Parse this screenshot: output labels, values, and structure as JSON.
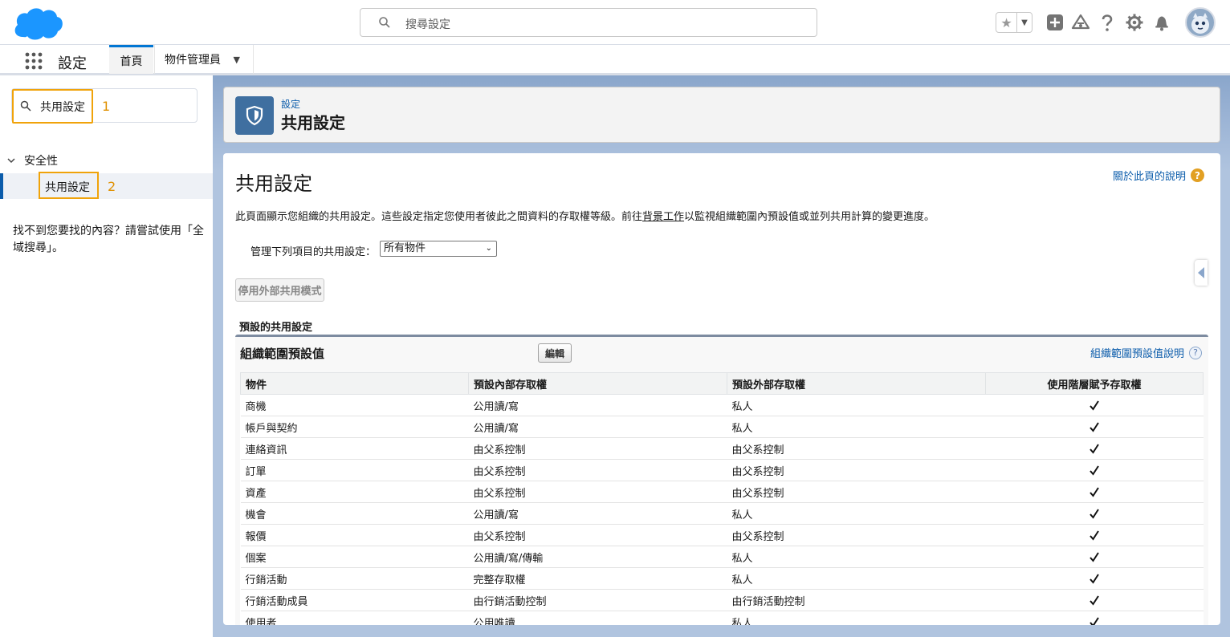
{
  "header": {
    "search_placeholder": "搜尋設定",
    "icons": [
      "salesforce-cloud-logo",
      "search-icon",
      "star-icon",
      "chevron-down-icon",
      "add-icon",
      "trailhead-icon",
      "help-icon",
      "gear-icon",
      "bell-icon",
      "avatar"
    ]
  },
  "context_bar": {
    "app_title": "設定",
    "tabs": [
      {
        "label": "首頁",
        "active": true
      },
      {
        "label": "物件管理員",
        "active": false
      }
    ]
  },
  "sidebar": {
    "quick_find_value": "共用設定",
    "annotation_1": "1",
    "tree_section": "安全性",
    "tree_item": "共用設定",
    "annotation_2": "2",
    "not_found_text": "找不到您要找的內容？請嘗試使用「全域搜尋」。"
  },
  "page_header": {
    "breadcrumb": "設定",
    "title": "共用設定"
  },
  "content": {
    "heading": "共用設定",
    "help_link": "關於此頁的說明",
    "desc_before": "此頁面顯示您組織的共用設定。這些設定指定您使用者彼此之間資料的存取權等級。前往",
    "desc_link": "背景工作",
    "desc_after": "以監視組織範圍內預設值或並列共用計算的變更進度。",
    "manage_label": "管理下列項目的共用設定：",
    "manage_select": "所有物件",
    "disable_external_button": "停用外部共用模式",
    "section_label": "預設的共用設定",
    "block_title": "組織範圍預設值",
    "edit_button": "編輯",
    "block_help": "組織範圍預設值說明",
    "table": {
      "headers": [
        "物件",
        "預設內部存取權",
        "預設外部存取權",
        "使用階層賦予存取權"
      ],
      "rows": [
        {
          "object": "商機",
          "internal": "公用讀/寫",
          "external": "私人",
          "hierarchy": true
        },
        {
          "object": "帳戶與契約",
          "internal": "公用讀/寫",
          "external": "私人",
          "hierarchy": true
        },
        {
          "object": "連絡資訊",
          "internal": "由父系控制",
          "external": "由父系控制",
          "hierarchy": true
        },
        {
          "object": "訂單",
          "internal": "由父系控制",
          "external": "由父系控制",
          "hierarchy": true
        },
        {
          "object": "資產",
          "internal": "由父系控制",
          "external": "由父系控制",
          "hierarchy": true
        },
        {
          "object": "機會",
          "internal": "公用讀/寫",
          "external": "私人",
          "hierarchy": true
        },
        {
          "object": "報價",
          "internal": "由父系控制",
          "external": "由父系控制",
          "hierarchy": true
        },
        {
          "object": "個案",
          "internal": "公用讀/寫/傳輸",
          "external": "私人",
          "hierarchy": true
        },
        {
          "object": "行銷活動",
          "internal": "完整存取權",
          "external": "私人",
          "hierarchy": true
        },
        {
          "object": "行銷活動成員",
          "internal": "由行銷活動控制",
          "external": "由行銷活動控制",
          "hierarchy": true
        },
        {
          "object": "使用者",
          "internal": "公用唯讀",
          "external": "私人",
          "hierarchy": true
        }
      ]
    }
  }
}
